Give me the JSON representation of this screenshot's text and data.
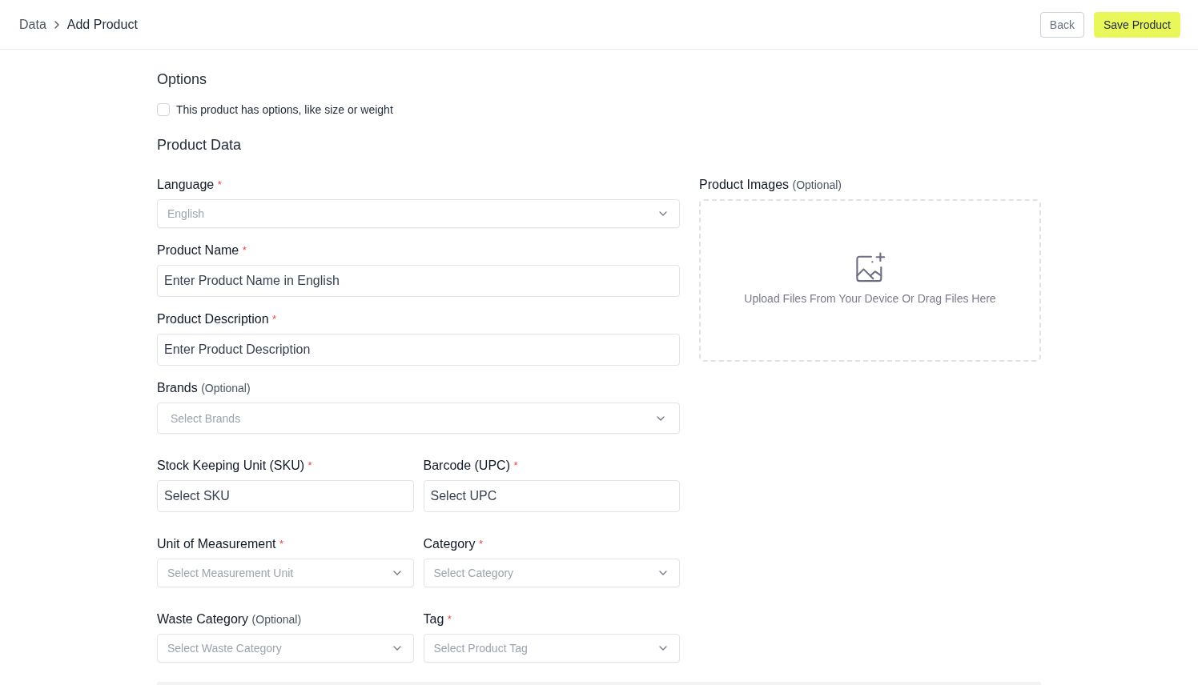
{
  "header": {
    "breadcrumb": [
      {
        "label": "Data",
        "current": false
      },
      {
        "label": "Add Product",
        "current": true
      }
    ],
    "buttons": [
      {
        "label": "Back",
        "kind": "secondary"
      },
      {
        "label": "Save Product",
        "kind": "primary"
      }
    ]
  },
  "options": {
    "title": "Options",
    "checkbox": {
      "label": "This product has options, like size or weight",
      "checked": false
    }
  },
  "product_data": {
    "title": "Product Data",
    "rows": [
      {
        "fields": [
          {
            "label": "Language",
            "mark": "*",
            "kind": "select",
            "value": "English",
            "disabled": true
          }
        ]
      },
      {
        "fields": [
          {
            "label": "Product Name",
            "mark": "*",
            "kind": "input",
            "placeholder": "Enter Product Name in English"
          }
        ]
      },
      {
        "fields": [
          {
            "label": "Product Description",
            "mark": "*",
            "kind": "input",
            "placeholder": "Enter Product Description"
          }
        ]
      },
      {
        "fields": [
          {
            "label": "Brands",
            "note": "(Optional)",
            "kind": "select",
            "placeholder": "Select Brands"
          }
        ]
      },
      {
        "fields": [
          {
            "label": "Stock Keeping Unit (SKU)",
            "mark": "*",
            "kind": "input",
            "placeholder": "Select SKU"
          },
          {
            "label": "Barcode (UPC)",
            "mark": "*",
            "kind": "input",
            "placeholder": "Select UPC"
          }
        ]
      },
      {
        "fields": [
          {
            "label": "Unit of Measurement",
            "mark": "*",
            "kind": "select",
            "placeholder": "Select Measurement Unit"
          },
          {
            "label": "Category",
            "mark": "*",
            "kind": "select",
            "placeholder": "Select Category"
          }
        ]
      },
      {
        "fields": [
          {
            "label": "Waste Category",
            "note": "(Optional)",
            "kind": "select",
            "placeholder": "Select Waste Category"
          },
          {
            "label": "Tag",
            "mark": "*",
            "kind": "select",
            "placeholder": "Select Product Tag"
          }
        ]
      }
    ],
    "images": {
      "label": "Product Images",
      "note": "(Optional)",
      "hint": "Upload Files From Your Device Or Drag Files Here"
    }
  }
}
